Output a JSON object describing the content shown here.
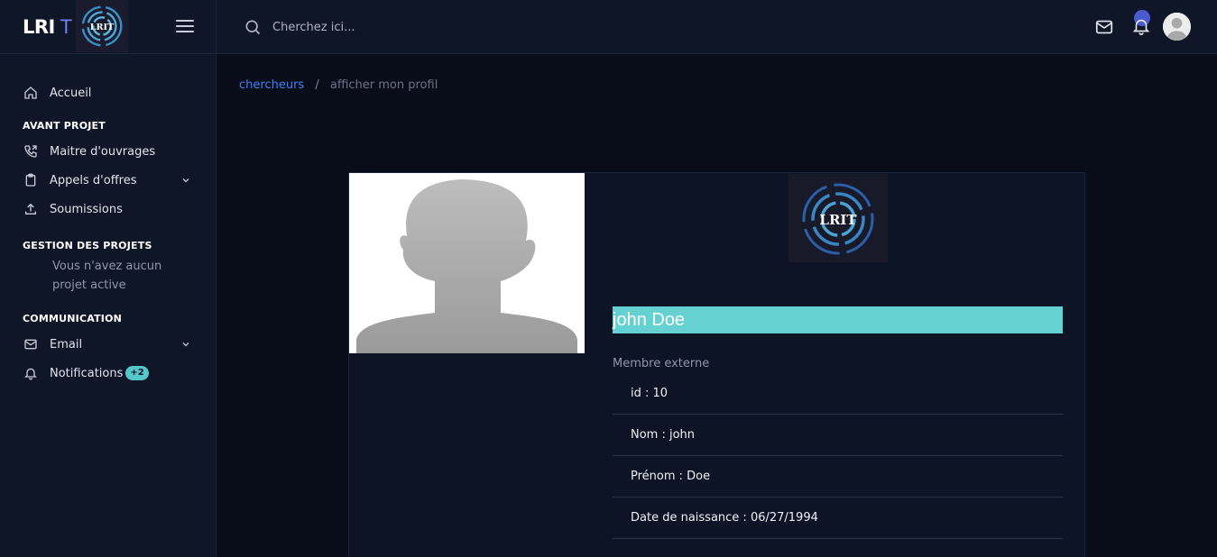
{
  "brand": {
    "text": "LRI",
    "suffix": "T",
    "logo_text": "LRIT"
  },
  "sidebar": {
    "home": "Accueil",
    "section_avant_projet": "AVANT PROJET",
    "maitre_ouvrages": "Maitre d'ouvrages",
    "appels_offres": "Appels d'offres",
    "soumissions": "Soumissions",
    "section_gestion": "GESTION DES PROJETS",
    "no_project_note": "Vous n'avez aucun projet active",
    "section_communication": "COMMUNICATION",
    "email": "Email",
    "notifications": "Notifications",
    "notifications_badge": "+2"
  },
  "topbar": {
    "search_placeholder": "Cherchez ici..."
  },
  "breadcrumb": {
    "link": "chercheurs",
    "separator": "/",
    "current": "afficher mon profil"
  },
  "profile": {
    "name": "john Doe",
    "member_type": "Membre externe",
    "fields": [
      "id : 10",
      "Nom : john",
      "Prénom : Doe",
      "Date de naissance : 06/27/1994"
    ]
  },
  "colors": {
    "accent": "#66d1d1",
    "link": "#3b82f6",
    "background": "#090d1a",
    "panel": "#0f1627"
  }
}
